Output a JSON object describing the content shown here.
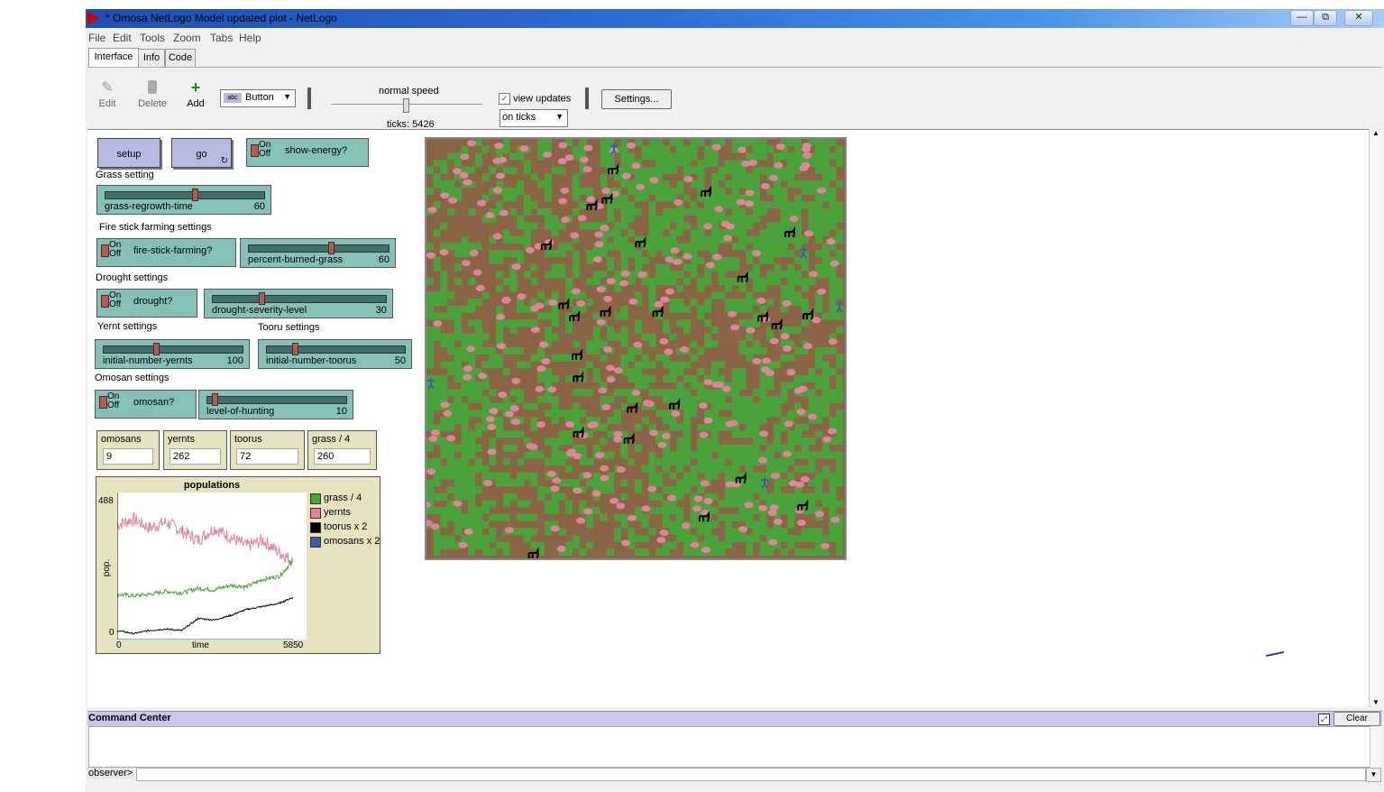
{
  "window": {
    "title": "* Omosa NetLogo Model updated plot - NetLogo",
    "minimize": "—",
    "maximize": "⧉",
    "close": "✕"
  },
  "menu": [
    "File",
    "Edit",
    "Tools",
    "Zoom",
    "Tabs",
    "Help"
  ],
  "tabs": [
    "Interface",
    "Info",
    "Code"
  ],
  "toolbar": {
    "edit": "Edit",
    "delete": "Delete",
    "add": "Add",
    "widget_type": "Button",
    "speed_label": "normal speed",
    "speed_fraction": 0.5,
    "ticks": "ticks: 5426",
    "view_updates_label": "view updates",
    "view_updates_checked": true,
    "update_mode": "on ticks",
    "settings": "Settings..."
  },
  "buttons": {
    "setup": "setup",
    "go": "go"
  },
  "switches": {
    "show_energy": {
      "label": "show-energy?",
      "on": "On",
      "off": "Off"
    },
    "fire_stick": {
      "label": "fire-stick-farming?",
      "on": "On",
      "off": "Off"
    },
    "drought": {
      "label": "drought?",
      "on": "On",
      "off": "Off"
    },
    "omosan": {
      "label": "omosan?",
      "on": "On",
      "off": "Off"
    }
  },
  "section_labels": {
    "grass": "Grass setting",
    "fire": "Fire stick farming settings",
    "drought": "Drought settings",
    "yernt": "Yernt settings",
    "tooru": "Tooru settings",
    "omosan": "Omosan settings"
  },
  "sliders": {
    "grass_regrowth": {
      "name": "grass-regrowth-time",
      "value": "60",
      "fraction": 0.57
    },
    "percent_burned": {
      "name": "percent-burned-grass",
      "value": "60",
      "fraction": 0.6
    },
    "drought_severity": {
      "name": "drought-severity-level",
      "value": "30",
      "fraction": 0.28
    },
    "initial_yernts": {
      "name": "initial-number-yernts",
      "value": "100",
      "fraction": 0.38
    },
    "initial_toorus": {
      "name": "initial-number-toorus",
      "value": "50",
      "fraction": 0.2
    },
    "hunting": {
      "name": "level-of-hunting",
      "value": "10",
      "fraction": 0.04
    }
  },
  "monitors": [
    {
      "label": "omosans",
      "value": "9"
    },
    {
      "label": "yernts",
      "value": "262"
    },
    {
      "label": "toorus",
      "value": "72"
    },
    {
      "label": "grass / 4",
      "value": "260"
    }
  ],
  "plot": {
    "title": "populations",
    "ymax_label": "488",
    "ymin_label": "0",
    "xmin_label": "0",
    "xmax_label": "5850",
    "xlabel": "time",
    "ylabel": "pop.",
    "legend": [
      {
        "name": "grass / 4",
        "color": "#4aa23a"
      },
      {
        "name": "yernts",
        "color": "#e0849a"
      },
      {
        "name": "toorus x 2",
        "color": "#000000"
      },
      {
        "name": "omosans x 2",
        "color": "#3b5ea8"
      }
    ]
  },
  "chart_data": {
    "type": "line",
    "title": "populations",
    "xlabel": "time",
    "ylabel": "pop.",
    "xlim": [
      0,
      5850
    ],
    "ylim": [
      0,
      488
    ],
    "legend": "right",
    "series": [
      {
        "name": "yernts",
        "color": "#e0849a",
        "x": [
          0,
          500,
          1000,
          1500,
          2000,
          2500,
          3000,
          3500,
          4000,
          4500,
          5000,
          5426
        ],
        "values": [
          380,
          400,
          370,
          390,
          360,
          330,
          370,
          340,
          310,
          330,
          290,
          262
        ]
      },
      {
        "name": "grass / 4",
        "color": "#4aa23a",
        "x": [
          0,
          500,
          1000,
          1500,
          2000,
          2500,
          3000,
          3500,
          4000,
          4500,
          5000,
          5426
        ],
        "values": [
          150,
          145,
          150,
          160,
          155,
          170,
          165,
          180,
          175,
          200,
          210,
          260
        ]
      },
      {
        "name": "toorus x 2",
        "color": "#000000",
        "x": [
          0,
          500,
          1000,
          1500,
          2000,
          2500,
          3000,
          3500,
          4000,
          4500,
          5000,
          5426
        ],
        "values": [
          30,
          20,
          30,
          35,
          30,
          70,
          65,
          80,
          100,
          110,
          120,
          140
        ]
      },
      {
        "name": "omosans x 2",
        "color": "#3b5ea8",
        "x": [
          0,
          5426
        ],
        "values": [
          0,
          0
        ]
      }
    ]
  },
  "command_center": {
    "title": "Command Center",
    "clear": "Clear",
    "prompt": "observer>"
  },
  "colors": {
    "button": "#b8b9e0",
    "widget_green": "#86c1b8",
    "monitor": "#e6e3bf",
    "patch_brown": "#8b6445",
    "patch_green": "#4aa23a",
    "yernt_pink": "#e0849a",
    "tooru_black": "#000000",
    "omosan_blue": "#3b5ea8"
  }
}
